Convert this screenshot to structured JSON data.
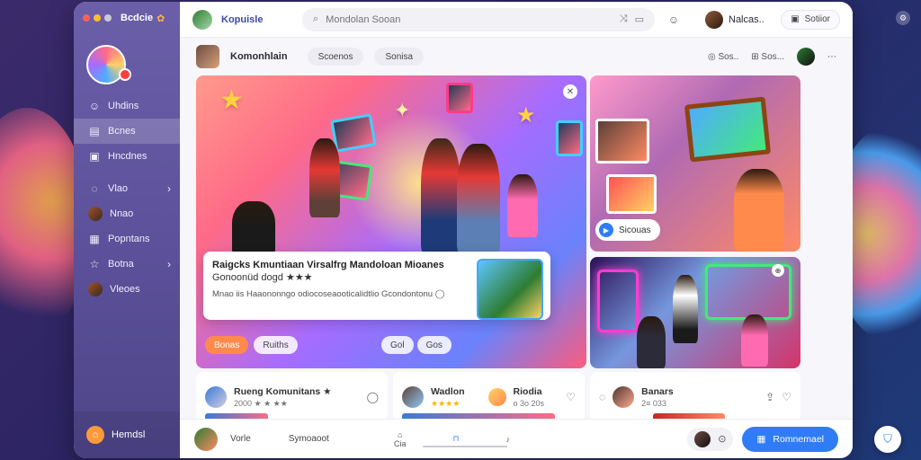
{
  "app": {
    "name": "Bcdcie"
  },
  "sidebar": {
    "items": [
      {
        "label": "Uhdins",
        "icon": "smile-icon"
      },
      {
        "label": "Bcnes",
        "icon": "book-icon",
        "active": true
      },
      {
        "label": "Hncdnes",
        "icon": "gallery-icon"
      },
      {
        "label": "Vlao",
        "icon": "chat-icon",
        "chevron": true
      },
      {
        "label": "Nnao",
        "icon": "avatar"
      },
      {
        "label": "Popntans",
        "icon": "group-icon"
      },
      {
        "label": "Botna",
        "icon": "star-icon",
        "chevron": true
      },
      {
        "label": "Vleoes",
        "icon": "avatar"
      }
    ],
    "footer_label": "Hemdsl"
  },
  "topbar": {
    "brand": "Kopuisle",
    "search_placeholder": "Mondolan Sooan",
    "user_name": "Nalcas..",
    "pill_label": "Sotiior"
  },
  "subbar": {
    "title": "Komonhlain",
    "chips": [
      "Scoenos",
      "Sonisa"
    ],
    "right_items": [
      "Sos..",
      "Sos..."
    ]
  },
  "hero": {
    "caption_title": "Raigcks Kmuntiaan Virsalfrg Mandoloan Mioanes",
    "caption_sub": "Gonoonüd dogd ★★★",
    "caption_desc": "Mnao iis Haaononngo odiocoseaooticalidtlio Gcondontonu ◯",
    "tags_left": [
      "Bonas",
      "Ruiths"
    ],
    "tags_right": [
      "Gol",
      "Gos"
    ]
  },
  "side_card": {
    "label": "Sicouas"
  },
  "cards": [
    {
      "title": "Rueng Komunitans ★",
      "sub": "2000 ★ ★ ★★"
    },
    {
      "title": "Wadlon",
      "sub": "★★★★"
    },
    {
      "title": "Riodia",
      "sub": "o 3o 20s"
    },
    {
      "title": "Banars",
      "sub": "2≡ 033"
    }
  ],
  "bottombar": {
    "left_text": "Vorle",
    "mid_text": "Symoaoot",
    "mid_icons": [
      {
        "icon": "home-icon",
        "label": "Cia"
      },
      {
        "icon": "bookmark-icon",
        "label": ""
      },
      {
        "icon": "bell-icon",
        "label": ""
      }
    ],
    "cta": "Romnemael"
  },
  "colors": {
    "accent": "#2f7cf6",
    "sidebar": "#5a4f98",
    "tag": "#ff8a4c"
  }
}
